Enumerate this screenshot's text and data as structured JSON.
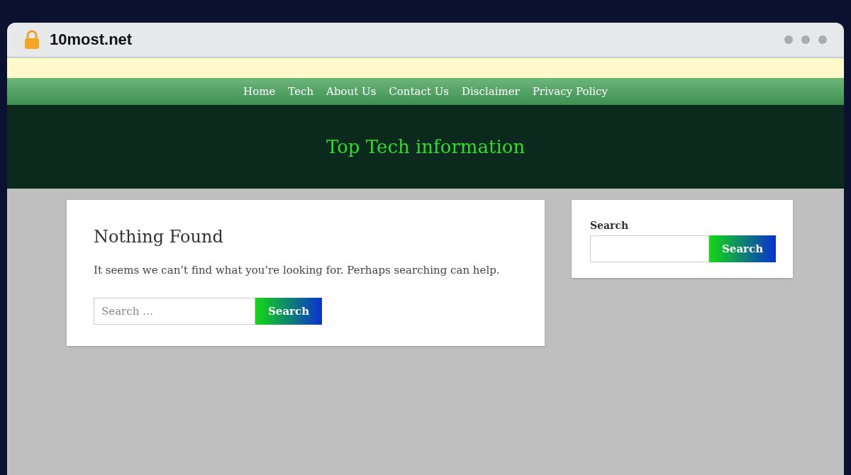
{
  "browser": {
    "address": "10most.net"
  },
  "nav": {
    "links": [
      {
        "label": "Home"
      },
      {
        "label": "Tech"
      },
      {
        "label": "About Us"
      },
      {
        "label": "Contact Us"
      },
      {
        "label": "Disclaimer"
      },
      {
        "label": "Privacy Policy"
      }
    ]
  },
  "header": {
    "site_title": "Top Tech information"
  },
  "main": {
    "title": "Nothing Found",
    "message": "It seems we can’t find what you’re looking for. Perhaps searching can help.",
    "search": {
      "placeholder": "Search …",
      "button": "Search"
    }
  },
  "sidebar": {
    "label": "Search",
    "button": "Search"
  }
}
